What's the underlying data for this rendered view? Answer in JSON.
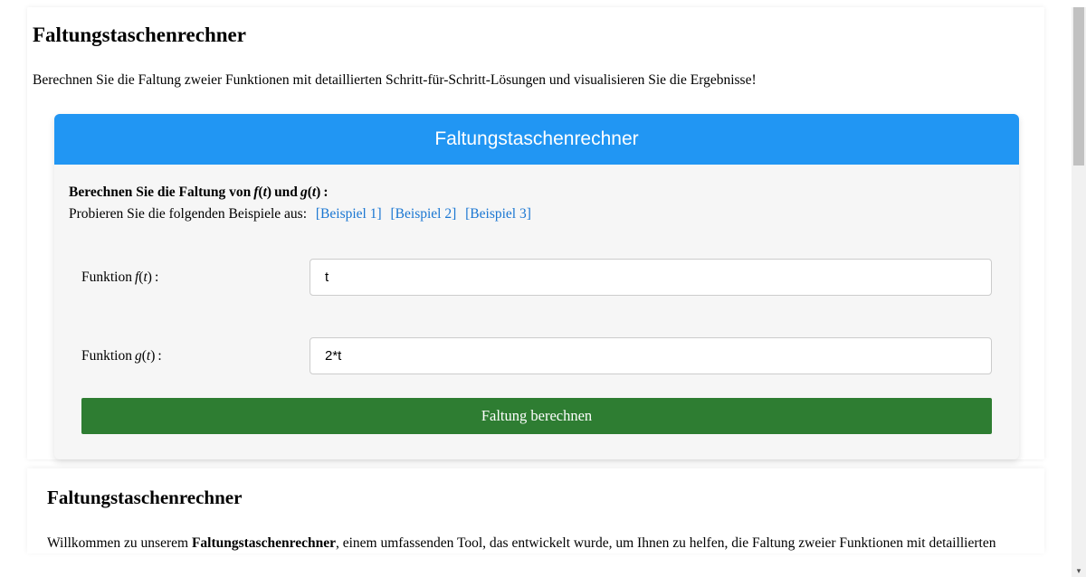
{
  "page": {
    "title": "Faltungstaschenrechner",
    "subtitle": "Berechnen Sie die Faltung zweier Funktionen mit detaillierten Schritt-für-Schritt-Lösungen und visualisieren Sie die Ergebnisse!"
  },
  "calculator": {
    "header": "Faltungstaschenrechner",
    "instruction_prefix": "Berechnen Sie die Faltung von ",
    "instruction_f": "f(t)",
    "instruction_and": " und ",
    "instruction_g": "g(t)",
    "instruction_colon": ":",
    "examples_prefix": "Probieren Sie die folgenden Beispiele aus: ",
    "example1": "[Beispiel 1]",
    "example2": "[Beispiel 2]",
    "example3": "[Beispiel 3]",
    "label_f_prefix": "Funktion ",
    "label_f_math": "f(t)",
    "label_f_colon": ":",
    "input_f_value": "t",
    "label_g_prefix": "Funktion ",
    "label_g_math": "g(t)",
    "label_g_colon": ":",
    "input_g_value": "2*t",
    "button": "Faltung berechnen"
  },
  "section": {
    "title": "Faltungstaschenrechner",
    "welcome_prefix": "Willkommen zu unserem ",
    "welcome_bold": "Faltungstaschenrechner",
    "welcome_suffix": ", einem umfassenden Tool, das entwickelt wurde, um Ihnen zu helfen, die Faltung zweier Funktionen mit detaillierten"
  }
}
